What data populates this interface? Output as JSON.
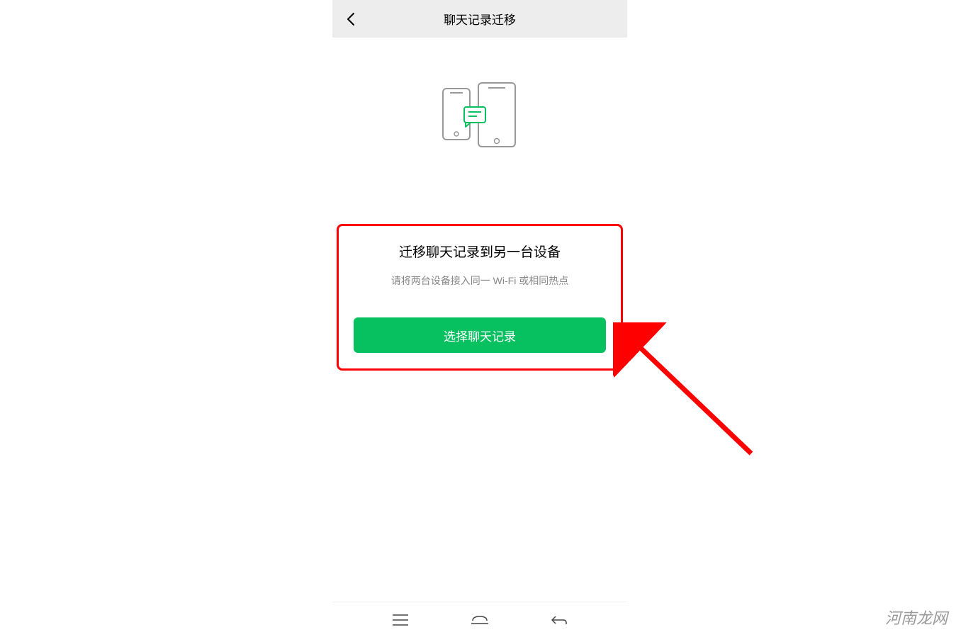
{
  "header": {
    "title": "聊天记录迁移"
  },
  "main": {
    "section_title": "迁移聊天记录到另一台设备",
    "section_desc": "请将两台设备接入同一 Wi-Fi 或相同热点",
    "button_label": "选择聊天记录"
  },
  "watermark": "河南龙网",
  "colors": {
    "primary": "#07c160",
    "highlight": "#ff0000",
    "header_bg": "#ededed"
  }
}
